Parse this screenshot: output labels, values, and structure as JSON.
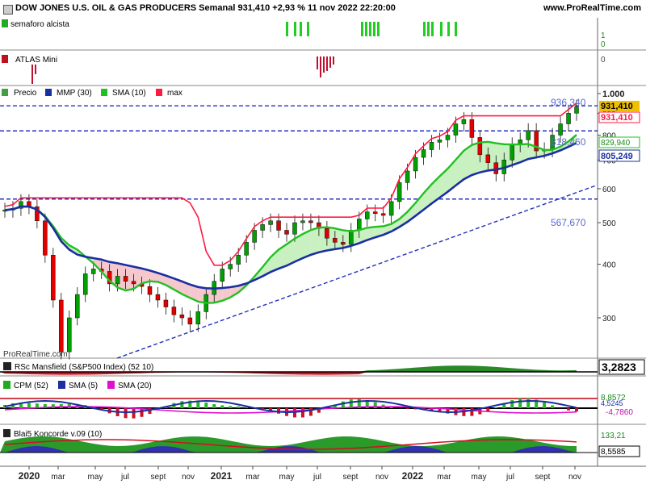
{
  "header": {
    "title": "DOW JONES U.S. OIL & GAS PRODUCERS Semanal 931,410 +2,93 % 11 nov 2022 22:20:00",
    "site": "www.ProRealTime.com"
  },
  "panels": {
    "semaforo": {
      "label": "semaforo alcista",
      "ticks": [
        "1",
        "0"
      ]
    },
    "atlas": {
      "label": "ATLAS Mini",
      "ticks": [
        "0"
      ]
    },
    "main": {
      "legend": [
        "Precio",
        "MMP (30)",
        "SMA (10)",
        "max"
      ],
      "watermark": "ProRealTime.com",
      "level_labels": [
        "936,340",
        "818,460",
        "567,670"
      ],
      "price_tags": [
        "931,410",
        "931,410",
        "829,940",
        "805,249"
      ],
      "y_ticks": [
        "1.000",
        "900",
        "800",
        "700",
        "600",
        "500",
        "400",
        "300"
      ]
    },
    "rsc": {
      "label": "RSc Mansfield (S&P500 Index) (52 10)",
      "value": "3,2823"
    },
    "cpm": {
      "labels": [
        "CPM (52)",
        "SMA (5)",
        "SMA (20)"
      ],
      "values": [
        "8,8572",
        "4,5245",
        "-4,7860"
      ]
    },
    "koncorde": {
      "label": "Blai5 Koncorde v.09 (10)",
      "values": [
        "133,21",
        "8,5585"
      ]
    }
  },
  "x_axis": [
    "2020",
    "mar",
    "may",
    "jul",
    "sept",
    "nov",
    "2021",
    "mar",
    "may",
    "jul",
    "sept",
    "nov",
    "2022",
    "mar",
    "may",
    "jul",
    "sept",
    "nov"
  ],
  "colors": {
    "price_up": "#00a000",
    "price_down": "#e00000",
    "mmp": "#1a2fa0",
    "sma": "#22c022",
    "max": "#ff1a40",
    "level": "#2030c0"
  },
  "chart_data": {
    "type": "candlestick",
    "title": "DOW JONES U.S. OIL & GAS PRODUCERS Semanal",
    "last_close": 931.41,
    "change_pct": 2.93,
    "date": "11 nov 2022",
    "y_scale": "log",
    "ylim": [
      250,
      1000
    ],
    "levels": [
      936.34,
      818.46,
      567.67
    ],
    "close_series": [
      535,
      540,
      560,
      545,
      505,
      420,
      330,
      250,
      300,
      340,
      380,
      390,
      385,
      360,
      375,
      365,
      360,
      355,
      340,
      330,
      318,
      305,
      300,
      290,
      310,
      340,
      365,
      390,
      400,
      420,
      450,
      480,
      495,
      505,
      480,
      470,
      500,
      505,
      500,
      485,
      460,
      450,
      445,
      480,
      510,
      530,
      525,
      520,
      560,
      620,
      660,
      710,
      740,
      770,
      780,
      800,
      850,
      870,
      790,
      720,
      690,
      650,
      700,
      760,
      780,
      820,
      735,
      740,
      800,
      850,
      900,
      931
    ]
  }
}
